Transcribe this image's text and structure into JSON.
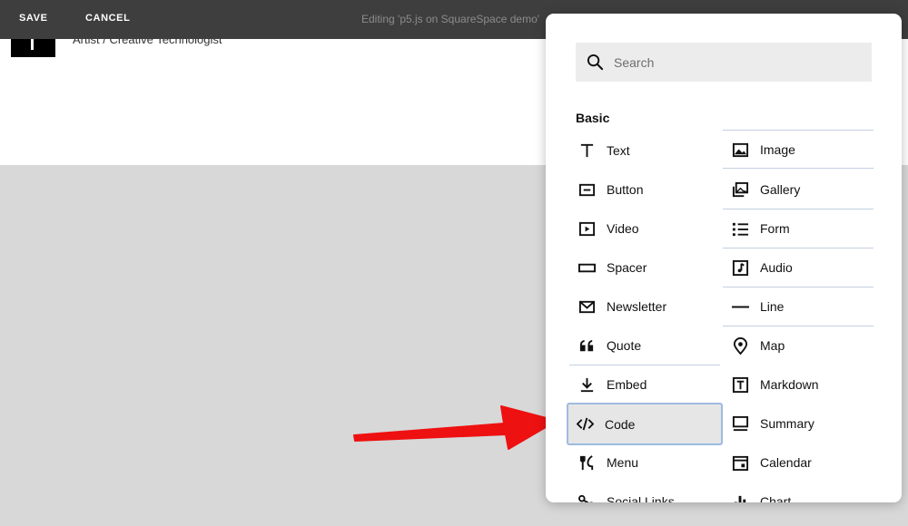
{
  "topbar": {
    "save_label": "SAVE",
    "cancel_label": "CANCEL",
    "editing_text": "Editing 'p5.js on SquareSpace demo'"
  },
  "header": {
    "tagline": "Artist / Creative Technologist"
  },
  "panel": {
    "search_placeholder": "Search",
    "section_title": "Basic",
    "left_blocks": [
      {
        "label": "Text",
        "icon": "text-icon"
      },
      {
        "label": "Button",
        "icon": "button-icon"
      },
      {
        "label": "Video",
        "icon": "video-icon"
      },
      {
        "label": "Spacer",
        "icon": "spacer-icon"
      },
      {
        "label": "Newsletter",
        "icon": "newsletter-icon"
      },
      {
        "label": "Quote",
        "icon": "quote-icon"
      },
      {
        "label": "Embed",
        "icon": "embed-icon"
      },
      {
        "label": "Code",
        "icon": "code-icon",
        "selected": true
      },
      {
        "label": "Menu",
        "icon": "menu-icon"
      },
      {
        "label": "Social Links",
        "icon": "social-links-icon"
      }
    ],
    "right_blocks": [
      {
        "label": "Image",
        "icon": "image-icon"
      },
      {
        "label": "Gallery",
        "icon": "gallery-icon"
      },
      {
        "label": "Form",
        "icon": "form-icon"
      },
      {
        "label": "Audio",
        "icon": "audio-icon"
      },
      {
        "label": "Line",
        "icon": "line-icon"
      },
      {
        "label": "Map",
        "icon": "map-icon"
      },
      {
        "label": "Markdown",
        "icon": "markdown-icon"
      },
      {
        "label": "Summary",
        "icon": "summary-icon"
      },
      {
        "label": "Calendar",
        "icon": "calendar-icon"
      },
      {
        "label": "Chart",
        "icon": "chart-icon"
      }
    ]
  },
  "colors": {
    "topbar": "#3e3e3e",
    "arrow": "#ee1111",
    "selected_border": "#9dbbe0",
    "separator": "#c3d0e2"
  }
}
